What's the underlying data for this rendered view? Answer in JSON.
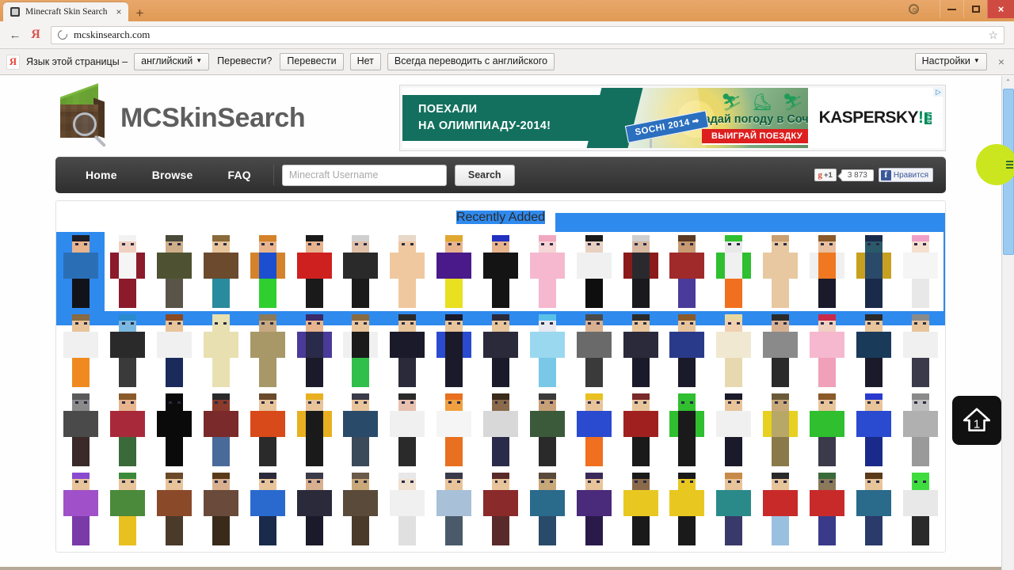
{
  "browser": {
    "tab": {
      "title": "Minecraft Skin Search",
      "favicon": "minecraft-block-icon",
      "close": "×"
    },
    "new_tab": "+",
    "window_controls": {
      "settings": "gear-icon",
      "minimize": "minimize-icon",
      "maximize": "maximize-icon",
      "close": "×"
    },
    "nav": {
      "back": "←",
      "yandex": "Я",
      "reload": "reload-icon",
      "bookmark": "☆"
    },
    "url": "mcskinsearch.com"
  },
  "translate_bar": {
    "logo": "Я",
    "label": "Язык этой страницы –",
    "language": "английский",
    "question": "Перевести?",
    "translate": "Перевести",
    "no": "Нет",
    "always": "Всегда переводить с английского",
    "settings": "Настройки",
    "close": "×"
  },
  "site": {
    "title": "MCSkinSearch",
    "logo": "minecraft-grass-block-magnifier-icon",
    "nav": [
      {
        "label": "Home",
        "name": "home"
      },
      {
        "label": "Browse",
        "name": "browse"
      },
      {
        "label": "FAQ",
        "name": "faq"
      }
    ],
    "search": {
      "value": "",
      "placeholder": "Minecraft Username",
      "button": "Search"
    },
    "social": {
      "gplus_label": "+1",
      "gplus_icon": "g",
      "gplus_count": "3 873",
      "fb_icon": "f",
      "fb_label": "Нравится"
    }
  },
  "ad": {
    "line1": "ПОЕХАЛИ",
    "line2": "НА ОЛИМПИАДУ-2014!",
    "sign": "SOCHI 2014",
    "headline": "Угадай погоду в Сочи",
    "cta": "ВЫИГРАЙ ПОЕЗДКУ",
    "brand": "KASPERSKY",
    "brand_accent": "!",
    "brand_lab": "lab",
    "ad_choice": "▷",
    "sports": [
      "⛷",
      "⛸",
      "⛷",
      "⛷"
    ]
  },
  "content": {
    "section_title": "Recently Added",
    "selection_color": "#2f8aee"
  },
  "float_button": {
    "name": "upload-home-button",
    "badge": "1"
  },
  "scrollbar": {
    "up": "⌃",
    "down": "⌄",
    "position": 16
  },
  "skins": {
    "row1": [
      {
        "hair": "#1c1c24",
        "skin": "#e8b48e",
        "shirt": "#2a6fb5",
        "pants": "#12121a",
        "arms": "#2a6fb5"
      },
      {
        "hair": "#f2f2f2",
        "skin": "#f0d0c0",
        "shirt": "#f5f5f5",
        "pants": "#8b1a2b",
        "arms": "#8b1a2b"
      },
      {
        "hair": "#4a4a3a",
        "skin": "#cfae8a",
        "shirt": "#4e5232",
        "pants": "#5a5448",
        "arms": "#4e5232"
      },
      {
        "hair": "#8a6a3a",
        "skin": "#e8c49a",
        "shirt": "#6b4a2e",
        "pants": "#2a8a9e",
        "arms": "#6b4a2e"
      },
      {
        "hair": "#d4832a",
        "skin": "#e8b48e",
        "shirt": "#1b4fd0",
        "pants": "#2fcf2f",
        "arms": "#d4832a"
      },
      {
        "hair": "#1a1a1a",
        "skin": "#e8b48e",
        "shirt": "#cf2020",
        "pants": "#1a1a1a",
        "arms": "#cf2020"
      },
      {
        "hair": "#cfcfcf",
        "skin": "#e0c0a8",
        "shirt": "#2a2a2a",
        "pants": "#1a1a1a",
        "arms": "#2a2a2a"
      },
      {
        "hair": "#e8d8c8",
        "skin": "#f0c8a0",
        "shirt": "#f0c8a0",
        "pants": "#f0c8a0",
        "arms": "#f0c8a0"
      },
      {
        "hair": "#e0a830",
        "skin": "#e8b48e",
        "shirt": "#4a1a8a",
        "pants": "#e8e020",
        "arms": "#4a1a8a"
      },
      {
        "hair": "#2030c0",
        "skin": "#e8b48e",
        "shirt": "#141414",
        "pants": "#141414",
        "arms": "#141414"
      },
      {
        "hair": "#f0a8c0",
        "skin": "#f5d5d5",
        "shirt": "#f5b8cf",
        "pants": "#f5b8cf",
        "arms": "#f5b8cf"
      },
      {
        "hair": "#1a1a1a",
        "skin": "#e8d0c0",
        "shirt": "#f0f0f0",
        "pants": "#0e0e0e",
        "arms": "#f0f0f0"
      },
      {
        "hair": "#cfcfcf",
        "skin": "#d8b8a0",
        "shirt": "#2a2a2e",
        "pants": "#1a1a1e",
        "arms": "#8b1a1a"
      },
      {
        "hair": "#5a3a22",
        "skin": "#c89a72",
        "shirt": "#a02a2a",
        "pants": "#4a3a9a",
        "arms": "#a02a2a"
      },
      {
        "hair": "#2fbf2f",
        "skin": "#e8e8e8",
        "shirt": "#f0f0f0",
        "pants": "#f07020",
        "arms": "#2fbf2f"
      },
      {
        "hair": "#caa070",
        "skin": "#e8c8a0",
        "shirt": "#e8c8a0",
        "pants": "#e8c8a0",
        "arms": "#e8c8a0"
      },
      {
        "hair": "#8a5a2a",
        "skin": "#e8c0a0",
        "shirt": "#f07820",
        "pants": "#1a1a2a",
        "arms": "#f0f0f0"
      },
      {
        "hair": "#1a2a4a",
        "skin": "#2a5a6a",
        "shirt": "#2a4a6a",
        "pants": "#1a2a4a",
        "arms": "#c8a020"
      },
      {
        "hair": "#f0a0c8",
        "skin": "#f5e0d0",
        "shirt": "#f5f5f5",
        "pants": "#e8e8e8",
        "arms": "#f5f5f5"
      }
    ],
    "row2": [
      {
        "hair": "#8a6a40",
        "skin": "#e8c49a",
        "shirt": "#f0f0f0",
        "pants": "#f08a20",
        "arms": "#f0f0f0"
      },
      {
        "hair": "#2a8acf",
        "skin": "#7ab8e0",
        "shirt": "#2a2a2a",
        "pants": "#3a3a3a",
        "arms": "#2a2a2a"
      },
      {
        "hair": "#8a4a22",
        "skin": "#e8c49a",
        "shirt": "#f0f0f0",
        "pants": "#1a2a5a",
        "arms": "#f0f0f0"
      },
      {
        "hair": "#e8e0b0",
        "skin": "#e8e0b0",
        "shirt": "#e8e0b0",
        "pants": "#e8e0b0",
        "arms": "#e8e0b0"
      },
      {
        "hair": "#8a7a5a",
        "skin": "#c8a880",
        "shirt": "#a89868",
        "pants": "#a89868",
        "arms": "#a89868"
      },
      {
        "hair": "#3a2a6a",
        "skin": "#e8b48e",
        "shirt": "#2a2a4a",
        "pants": "#1a1a2a",
        "arms": "#4a3a9a"
      },
      {
        "hair": "#8a6a40",
        "skin": "#e8c49a",
        "shirt": "#1a1a1a",
        "pants": "#2fbf4a",
        "arms": "#f0f0f0"
      },
      {
        "hair": "#2a2a2a",
        "skin": "#e8c49a",
        "shirt": "#1a1a2a",
        "pants": "#2a2a3a",
        "arms": "#1a1a2a"
      },
      {
        "hair": "#1a1a2a",
        "skin": "#e8c49a",
        "shirt": "#1a1a2a",
        "pants": "#1a1a2a",
        "arms": "#2a4acf"
      },
      {
        "hair": "#2a2a3a",
        "skin": "#e8c49a",
        "shirt": "#2a2a3a",
        "pants": "#1a1a2a",
        "arms": "#2a2a3a"
      },
      {
        "hair": "#5ac0e8",
        "skin": "#e8e8f0",
        "shirt": "#9ad8f0",
        "pants": "#7ac8e8",
        "arms": "#9ad8f0"
      },
      {
        "hair": "#4a4a4a",
        "skin": "#d8b090",
        "shirt": "#6a6a6a",
        "pants": "#3a3a3a",
        "arms": "#6a6a6a"
      },
      {
        "hair": "#2a2a2a",
        "skin": "#e8c49a",
        "shirt": "#2a2a3a",
        "pants": "#1a1a2a",
        "arms": "#2a2a3a"
      },
      {
        "hair": "#8a5a2a",
        "skin": "#e8c49a",
        "shirt": "#2a3a8a",
        "pants": "#1a1a2a",
        "arms": "#2a3a8a"
      },
      {
        "hair": "#e8d8a0",
        "skin": "#f0d0b0",
        "shirt": "#f0e8d0",
        "pants": "#e8d8b0",
        "arms": "#f0e8d0"
      },
      {
        "hair": "#2a2a2a",
        "skin": "#d8b090",
        "shirt": "#8a8a8a",
        "pants": "#2a2a2a",
        "arms": "#8a8a8a"
      },
      {
        "hair": "#c82a4a",
        "skin": "#f0d0c0",
        "shirt": "#f5b8cf",
        "pants": "#f0a0b8",
        "arms": "#f5b8cf"
      },
      {
        "hair": "#2a2a2a",
        "skin": "#e8c49a",
        "shirt": "#1a3a5a",
        "pants": "#1a1a2a",
        "arms": "#1a3a5a"
      },
      {
        "hair": "#8a8a8a",
        "skin": "#e8c49a",
        "shirt": "#f0f0f0",
        "pants": "#3a3a4a",
        "arms": "#f0f0f0"
      }
    ],
    "row3": [
      {
        "hair": "#5a5a5a",
        "skin": "#8a8a8a",
        "shirt": "#4a4a4a",
        "pants": "#3a2a2a",
        "arms": "#4a4a4a"
      },
      {
        "hair": "#8a5a2a",
        "skin": "#e8b48e",
        "shirt": "#a82a3a",
        "pants": "#3a6a3a",
        "arms": "#a82a3a"
      },
      {
        "hair": "#0a0a0a",
        "skin": "#0a0a0a",
        "shirt": "#0a0a0a",
        "pants": "#0a0a0a",
        "arms": "#0a0a0a"
      },
      {
        "hair": "#2a2a2a",
        "skin": "#8a3a2a",
        "shirt": "#7a2a2a",
        "pants": "#4a6a9a",
        "arms": "#7a2a2a"
      },
      {
        "hair": "#6a4a2a",
        "skin": "#e8c49a",
        "shirt": "#d84a1a",
        "pants": "#2a2a2a",
        "arms": "#d84a1a"
      },
      {
        "hair": "#e8b020",
        "skin": "#e8c49a",
        "shirt": "#1a1a1a",
        "pants": "#1a1a1a",
        "arms": "#e8b020"
      },
      {
        "hair": "#3a3a4a",
        "skin": "#e8c49a",
        "shirt": "#2a4a6a",
        "pants": "#3a4a5a",
        "arms": "#2a4a6a"
      },
      {
        "hair": "#2a2a2a",
        "skin": "#e8c0b0",
        "shirt": "#f0f0f0",
        "pants": "#2a2a2a",
        "arms": "#f0f0f0"
      },
      {
        "hair": "#e87020",
        "skin": "#f0a040",
        "shirt": "#f5f5f5",
        "pants": "#e87020",
        "arms": "#f5f5f5"
      },
      {
        "hair": "#3a2a1a",
        "skin": "#8a6a4a",
        "shirt": "#d8d8d8",
        "pants": "#2a2a4a",
        "arms": "#d8d8d8"
      },
      {
        "hair": "#3a3a3a",
        "skin": "#c8a078",
        "shirt": "#3a5a3a",
        "pants": "#2a2a2a",
        "arms": "#3a5a3a"
      },
      {
        "hair": "#e8c020",
        "skin": "#e8c49a",
        "shirt": "#2a4acf",
        "pants": "#f07020",
        "arms": "#2a4acf"
      },
      {
        "hair": "#7a2a2a",
        "skin": "#e8c49a",
        "shirt": "#a02020",
        "pants": "#1a1a1a",
        "arms": "#a02020"
      },
      {
        "hair": "#2fbf2f",
        "skin": "#2fbf2f",
        "shirt": "#1a1a1a",
        "pants": "#1a1a1a",
        "arms": "#2fbf2f"
      },
      {
        "hair": "#1a1a2a",
        "skin": "#e8c49a",
        "shirt": "#f0f0f0",
        "pants": "#1a1a2a",
        "arms": "#f0f0f0"
      },
      {
        "hair": "#6a5a3a",
        "skin": "#c8a878",
        "shirt": "#b8a868",
        "pants": "#8a7a4a",
        "arms": "#e8d020"
      },
      {
        "hair": "#8a5a2a",
        "skin": "#e8c49a",
        "shirt": "#2fbf2f",
        "pants": "#3a3a4a",
        "arms": "#2fbf2f"
      },
      {
        "hair": "#2a3acf",
        "skin": "#e8c49a",
        "shirt": "#2a4acf",
        "pants": "#1a2a8a",
        "arms": "#2a4acf"
      },
      {
        "hair": "#8a8a8a",
        "skin": "#c0c0c0",
        "shirt": "#b0b0b0",
        "pants": "#9a9a9a",
        "arms": "#b0b0b0"
      }
    ],
    "row4": [
      {
        "hair": "#8a4acf",
        "skin": "#e8c49a",
        "shirt": "#a050c8",
        "pants": "#7a3aa8",
        "arms": "#a050c8"
      },
      {
        "hair": "#3a8a3a",
        "skin": "#e8c49a",
        "shirt": "#4a8a3a",
        "pants": "#e8c020",
        "arms": "#4a8a3a"
      },
      {
        "hair": "#6a4a2a",
        "skin": "#e8c49a",
        "shirt": "#8a4a2a",
        "pants": "#4a3a2a",
        "arms": "#8a4a2a"
      },
      {
        "hair": "#5a3a1a",
        "skin": "#d8b090",
        "shirt": "#6a4a3a",
        "pants": "#3a2a1a",
        "arms": "#6a4a3a"
      },
      {
        "hair": "#2a2a3a",
        "skin": "#e8c49a",
        "shirt": "#2a6acf",
        "pants": "#1a2a4a",
        "arms": "#2a6acf"
      },
      {
        "hair": "#3a3a4a",
        "skin": "#d8b090",
        "shirt": "#2a2a3a",
        "pants": "#1a1a2a",
        "arms": "#2a2a3a"
      },
      {
        "hair": "#6a5a4a",
        "skin": "#c8a878",
        "shirt": "#5a4a3a",
        "pants": "#4a3a2a",
        "arms": "#5a4a3a"
      },
      {
        "hair": "#e8e8e8",
        "skin": "#f0e0d0",
        "shirt": "#f0f0f0",
        "pants": "#e0e0e0",
        "arms": "#f0f0f0"
      },
      {
        "hair": "#3a3a4a",
        "skin": "#e8c49a",
        "shirt": "#a8c0d8",
        "pants": "#4a5a6a",
        "arms": "#a8c0d8"
      },
      {
        "hair": "#5a2a2a",
        "skin": "#e8c49a",
        "shirt": "#8a2a2a",
        "pants": "#5a2a2a",
        "arms": "#8a2a2a"
      },
      {
        "hair": "#5a4a3a",
        "skin": "#c8a878",
        "shirt": "#2a6a8a",
        "pants": "#2a4a6a",
        "arms": "#2a6a8a"
      },
      {
        "hair": "#3a2a5a",
        "skin": "#e8c49a",
        "shirt": "#4a2a7a",
        "pants": "#2a1a4a",
        "arms": "#4a2a7a"
      },
      {
        "hair": "#1a1a1a",
        "skin": "#8a6a4a",
        "shirt": "#e8c820",
        "pants": "#1a1a1a",
        "arms": "#e8c820"
      },
      {
        "hair": "#1a1a1a",
        "skin": "#e8c820",
        "shirt": "#e8c820",
        "pants": "#1a1a1a",
        "arms": "#e8c820"
      },
      {
        "hair": "#c88a4a",
        "skin": "#e8c49a",
        "shirt": "#2a8a8a",
        "pants": "#3a3a6a",
        "arms": "#2a8a8a"
      },
      {
        "hair": "#2a2a2a",
        "skin": "#e8c49a",
        "shirt": "#c82a2a",
        "pants": "#9ac0e0",
        "arms": "#c82a2a"
      },
      {
        "hair": "#3a6a3a",
        "skin": "#8a7a5a",
        "shirt": "#c82a2a",
        "pants": "#3a3a8a",
        "arms": "#c82a2a"
      },
      {
        "hair": "#5a3a1a",
        "skin": "#e8c49a",
        "shirt": "#2a6a8a",
        "pants": "#2a3a6a",
        "arms": "#2a6a8a"
      },
      {
        "hair": "#3fdc3f",
        "skin": "#3fdc3f",
        "shirt": "#e8e8e8",
        "pants": "#2a2a2a",
        "arms": "#e8e8e8"
      }
    ]
  }
}
